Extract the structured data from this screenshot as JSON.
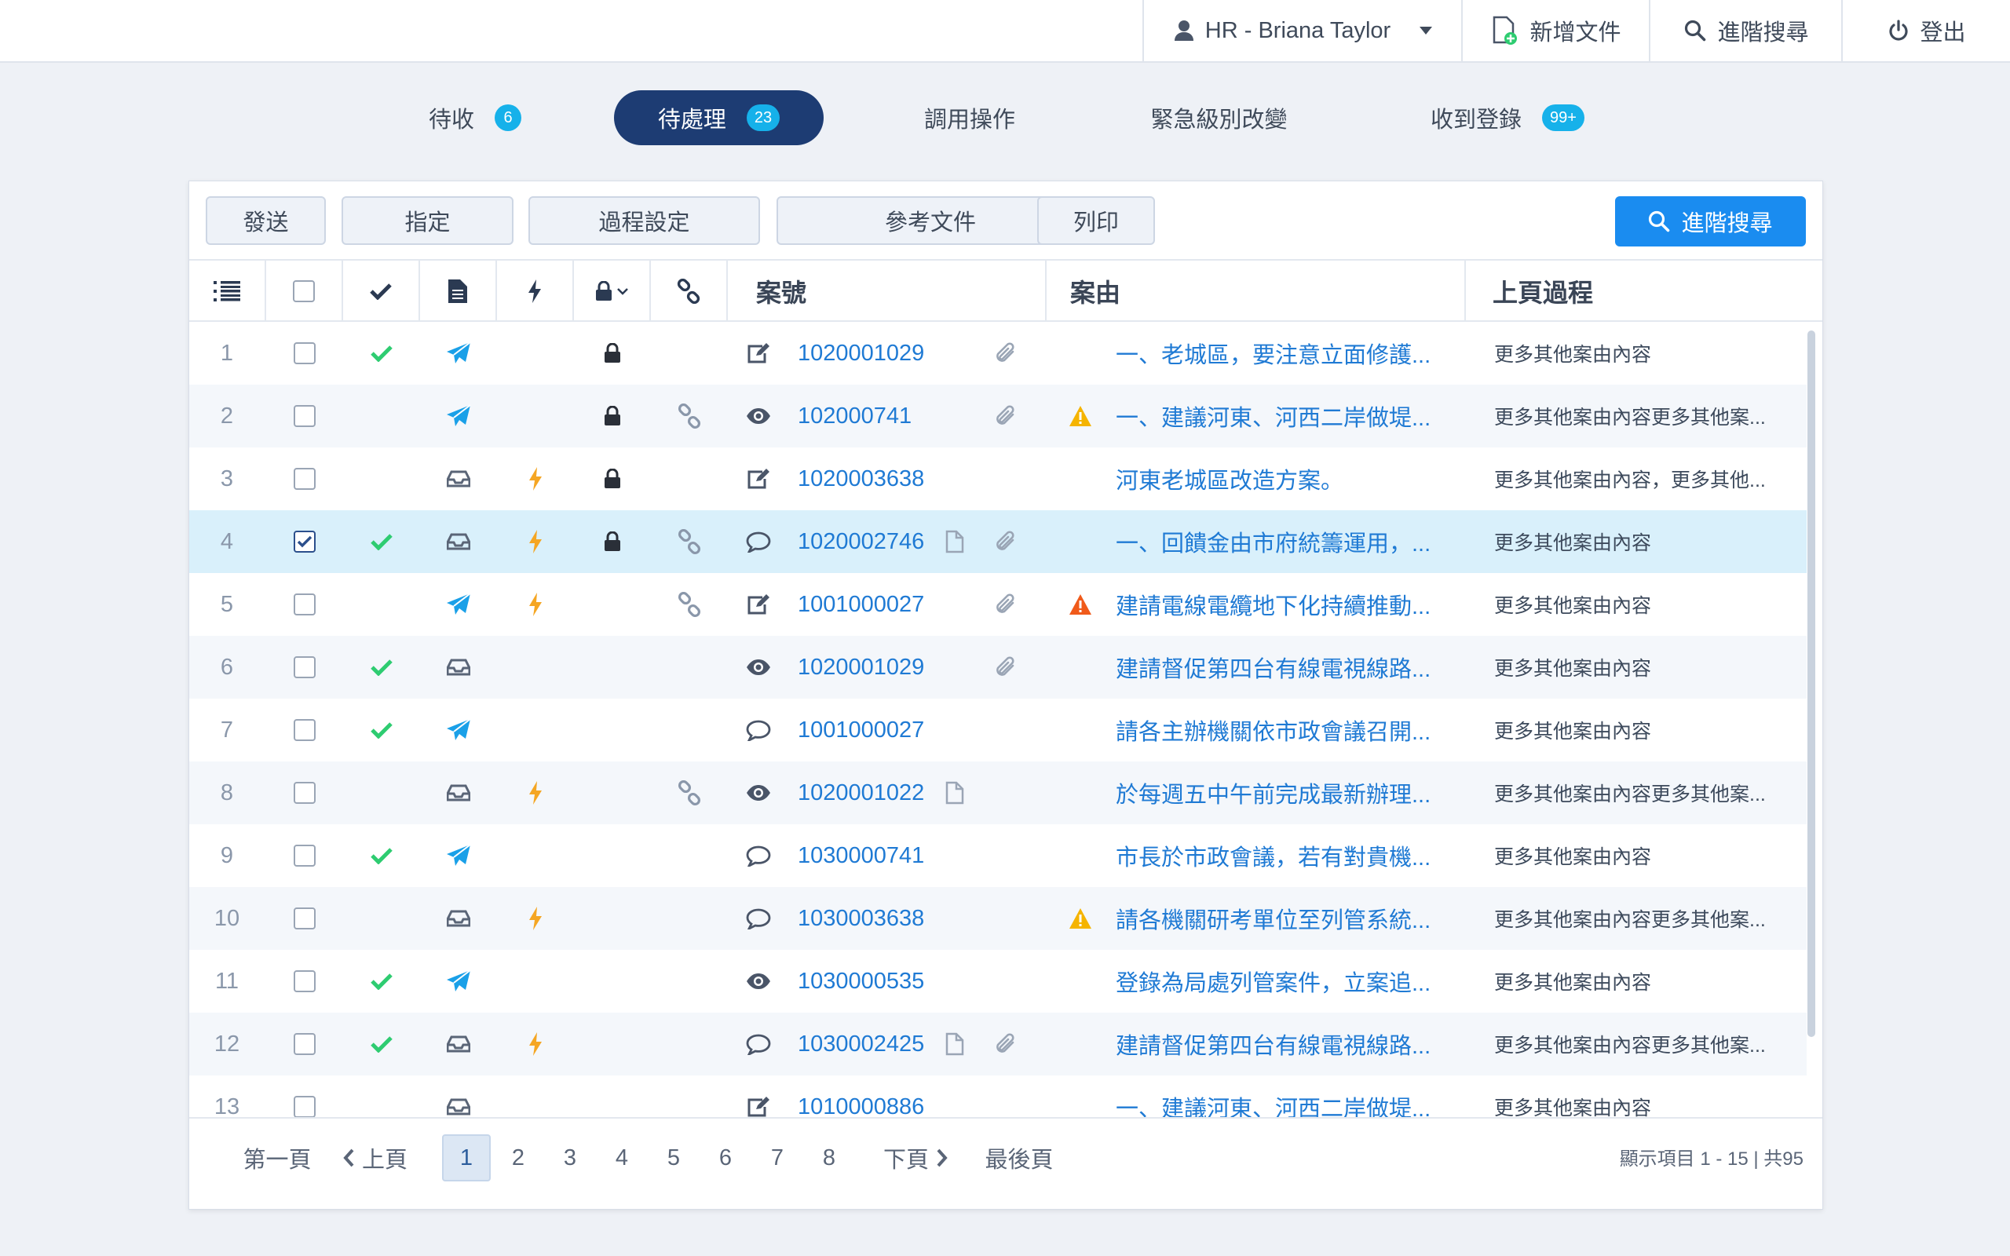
{
  "topbar": {
    "user_label": "HR - Briana Taylor",
    "new_doc_label": "新增文件",
    "adv_search_label": "進階搜尋",
    "logout_label": "登出"
  },
  "tabs": [
    {
      "label": "待收",
      "badge": "6"
    },
    {
      "label": "待處理",
      "badge": "23",
      "active": true
    },
    {
      "label": "調用操作"
    },
    {
      "label": "緊急級別改變"
    },
    {
      "label": "收到登錄",
      "badge": "99+"
    }
  ],
  "toolbar": {
    "send": "發送",
    "assign": "指定",
    "process_settings": "過程設定",
    "reference_docs": "參考文件",
    "print": "列印",
    "adv_search": "進階搜尋"
  },
  "columns": {
    "case_no": "案號",
    "reason": "案由",
    "prev_process": "上頁過程"
  },
  "colors": {
    "accent": "#1a8cf0",
    "active_tab": "#1d3c73",
    "badge": "#16b1ea",
    "link": "#1f7ad4",
    "check": "#2ecc71",
    "bolt": "#f5a623",
    "warn_yellow": "#f5b400",
    "warn_red": "#f05a1a",
    "selected_row": "#d9f0fb"
  },
  "rows": [
    {
      "n": "1",
      "checked": false,
      "done": true,
      "type": "send",
      "urgent": false,
      "locked": true,
      "linked": false,
      "status": "edit-icon",
      "case": "1020001029",
      "doc": false,
      "clip": true,
      "warn": "",
      "reason": "一、老城區，要注意立面修護...",
      "prev": "更多其他案由內容"
    },
    {
      "n": "2",
      "checked": false,
      "done": false,
      "type": "send",
      "urgent": false,
      "locked": true,
      "linked": true,
      "status": "eye-icon",
      "case": "102000741",
      "doc": false,
      "clip": true,
      "warn": "yellow",
      "reason": "一、建議河東、河西二岸做堤...",
      "prev": "更多其他案由內容更多其他案..."
    },
    {
      "n": "3",
      "checked": false,
      "done": false,
      "type": "inbox",
      "urgent": true,
      "locked": true,
      "linked": false,
      "status": "edit-icon",
      "case": "1020003638",
      "doc": false,
      "clip": false,
      "warn": "",
      "reason": "河東老城區改造方案。",
      "prev": "更多其他案由內容，更多其他..."
    },
    {
      "n": "4",
      "checked": true,
      "done": true,
      "type": "inbox",
      "urgent": true,
      "locked": true,
      "linked": true,
      "status": "comment-icon",
      "case": "1020002746",
      "doc": true,
      "clip": true,
      "warn": "",
      "reason": "一、回饋金由市府統籌運用，...",
      "prev": "更多其他案由內容"
    },
    {
      "n": "5",
      "checked": false,
      "done": false,
      "type": "send",
      "urgent": true,
      "locked": false,
      "linked": true,
      "status": "edit-icon",
      "case": "1001000027",
      "doc": false,
      "clip": true,
      "warn": "red",
      "reason": "建請電線電纜地下化持續推動...",
      "prev": "更多其他案由內容"
    },
    {
      "n": "6",
      "checked": false,
      "done": true,
      "type": "inbox",
      "urgent": false,
      "locked": false,
      "linked": false,
      "status": "eye-icon",
      "case": "1020001029",
      "doc": false,
      "clip": true,
      "warn": "",
      "reason": "建請督促第四台有線電視線路...",
      "prev": "更多其他案由內容"
    },
    {
      "n": "7",
      "checked": false,
      "done": true,
      "type": "send",
      "urgent": false,
      "locked": false,
      "linked": false,
      "status": "comment-icon",
      "case": "1001000027",
      "doc": false,
      "clip": false,
      "warn": "",
      "reason": "請各主辦機關依市政會議召開...",
      "prev": "更多其他案由內容"
    },
    {
      "n": "8",
      "checked": false,
      "done": false,
      "type": "inbox",
      "urgent": true,
      "locked": false,
      "linked": true,
      "status": "eye-icon",
      "case": "1020001022",
      "doc": true,
      "clip": false,
      "warn": "",
      "reason": "於每週五中午前完成最新辦理...",
      "prev": "更多其他案由內容更多其他案..."
    },
    {
      "n": "9",
      "checked": false,
      "done": true,
      "type": "send",
      "urgent": false,
      "locked": false,
      "linked": false,
      "status": "comment-icon",
      "case": "1030000741",
      "doc": false,
      "clip": false,
      "warn": "",
      "reason": "市長於市政會議，若有對貴機...",
      "prev": "更多其他案由內容"
    },
    {
      "n": "10",
      "checked": false,
      "done": false,
      "type": "inbox",
      "urgent": true,
      "locked": false,
      "linked": false,
      "status": "comment-icon",
      "case": "1030003638",
      "doc": false,
      "clip": false,
      "warn": "yellow",
      "reason": "請各機關研考單位至列管系統...",
      "prev": "更多其他案由內容更多其他案..."
    },
    {
      "n": "11",
      "checked": false,
      "done": true,
      "type": "send",
      "urgent": false,
      "locked": false,
      "linked": false,
      "status": "eye-icon",
      "case": "1030000535",
      "doc": false,
      "clip": false,
      "warn": "",
      "reason": "登錄為局處列管案件，立案追...",
      "prev": "更多其他案由內容"
    },
    {
      "n": "12",
      "checked": false,
      "done": true,
      "type": "inbox",
      "urgent": true,
      "locked": false,
      "linked": false,
      "status": "comment-icon",
      "case": "1030002425",
      "doc": true,
      "clip": true,
      "warn": "",
      "reason": "建請督促第四台有線電視線路...",
      "prev": "更多其他案由內容更多其他案..."
    },
    {
      "n": "13",
      "checked": false,
      "done": false,
      "type": "inbox",
      "urgent": false,
      "locked": false,
      "linked": false,
      "status": "edit-icon",
      "case": "1010000886",
      "doc": false,
      "clip": false,
      "warn": "",
      "reason": "一、建議河東、河西二岸做堤...",
      "prev": "更多其他案由內容"
    }
  ],
  "pager": {
    "first": "第一頁",
    "prev": "上頁",
    "pages": [
      "1",
      "2",
      "3",
      "4",
      "5",
      "6",
      "7",
      "8"
    ],
    "current": "1",
    "next": "下頁",
    "last": "最後頁",
    "info": "顯示項目 1 - 15  |  共95"
  }
}
